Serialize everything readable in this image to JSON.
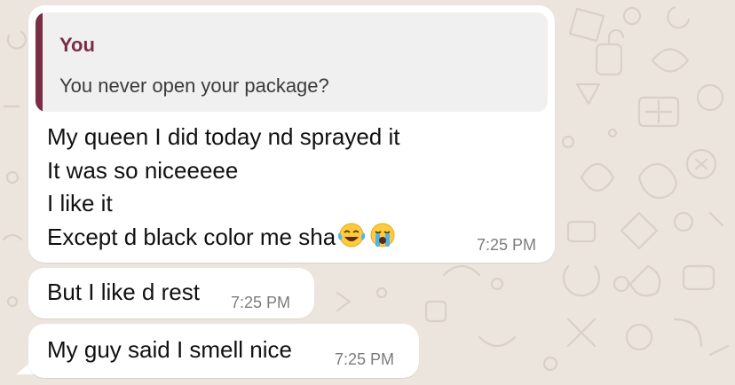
{
  "theme": {
    "wallpaper": "#ECE5DD",
    "bubble": "#FFFFFF",
    "quote_bg": "#F0F0F0",
    "quote_accent": "#7A2E45",
    "timestamp": "#7C7C7C"
  },
  "messages": [
    {
      "reply": {
        "author": "You",
        "text": "You never open your package?"
      },
      "lines": [
        "My queen I did today nd sprayed it",
        "It was so niceeeee",
        "I like it",
        "Except d black color me sha"
      ],
      "emojis": [
        "face-with-tears-of-joy-icon",
        "loudly-crying-face-icon"
      ],
      "time": "7:25 PM"
    },
    {
      "text": "But I like d rest",
      "time": "7:25 PM"
    },
    {
      "text": "My guy said I smell nice",
      "time": "7:25 PM"
    }
  ]
}
